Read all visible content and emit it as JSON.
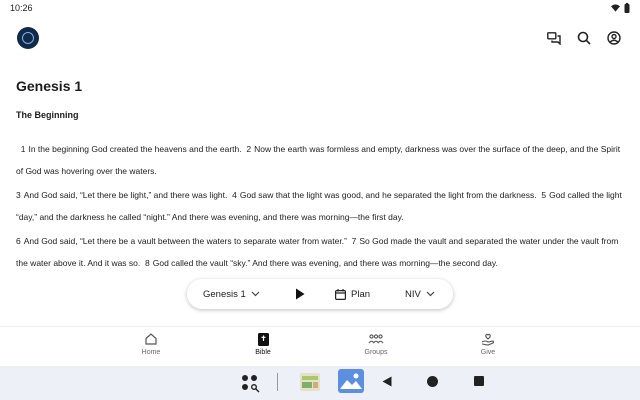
{
  "status": {
    "time": "10:26"
  },
  "chapter": {
    "title": "Genesis 1",
    "section_heading": "The Beginning",
    "paragraphs": [
      {
        "verses": [
          {
            "num": "1",
            "text": "In the beginning God created the heavens and the earth."
          },
          {
            "num": "2",
            "text": "Now the earth was formless and empty, darkness was over the surface of the deep, and the Spirit of God was hovering over the waters."
          }
        ]
      },
      {
        "verses": [
          {
            "num": "3",
            "text": "And God said, “Let there be light,” and there was light."
          },
          {
            "num": "4",
            "text": "God saw that the light was good, and he separated the light from the darkness."
          },
          {
            "num": "5",
            "text": "God called the light “day,” and the darkness he called “night.” And there was evening, and there was morning—the first day."
          }
        ]
      },
      {
        "verses": [
          {
            "num": "6",
            "text": "And God said, “Let there be a vault between the waters to separate water from water.”"
          },
          {
            "num": "7",
            "text": "So God made the vault and separated the water under the vault from the water above it. And it was so."
          },
          {
            "num": "8",
            "text": "God called the vault “sky.” And there was evening, and there was morning—the second day."
          }
        ]
      }
    ]
  },
  "reader_pill": {
    "book_chapter": "Genesis 1",
    "plan_label": "Plan",
    "version": "NIV"
  },
  "bottom_nav": {
    "home": "Home",
    "bible": "Bible",
    "groups": "Groups",
    "give": "Give"
  }
}
